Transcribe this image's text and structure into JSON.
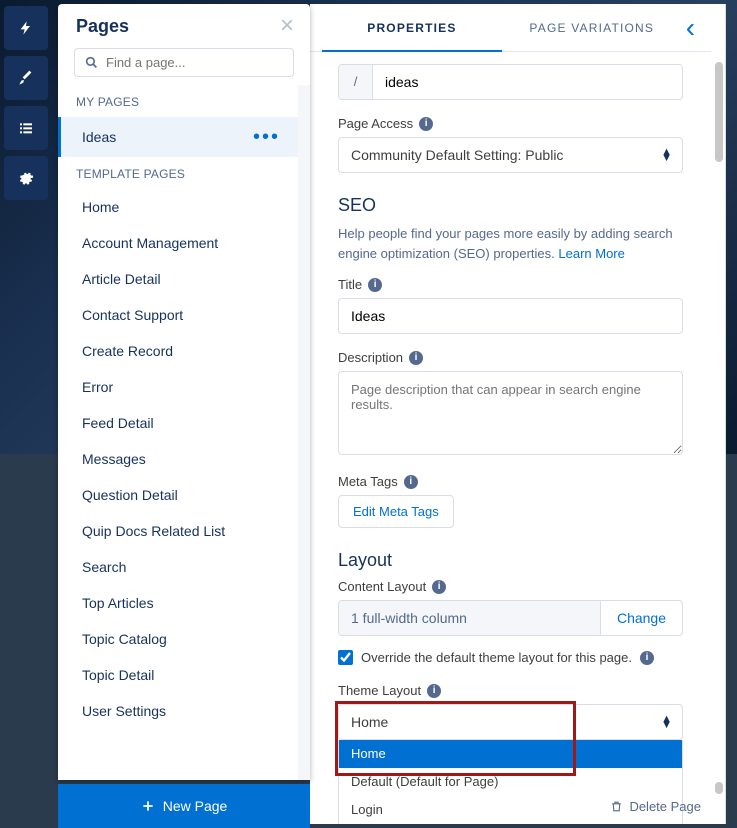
{
  "panel_title": "Pages",
  "search_placeholder": "Find a page...",
  "sections": {
    "my_pages": "MY PAGES",
    "template_pages": "TEMPLATE PAGES"
  },
  "my_pages": [
    {
      "label": "Ideas",
      "active": true
    }
  ],
  "template_pages": [
    "Home",
    "Account Management",
    "Article Detail",
    "Contact Support",
    "Create Record",
    "Error",
    "Feed Detail",
    "Messages",
    "Question Detail",
    "Quip Docs Related List",
    "Search",
    "Top Articles",
    "Topic Catalog",
    "Topic Detail",
    "User Settings"
  ],
  "new_page_label": "New Page",
  "tabs": {
    "properties": "PROPERTIES",
    "variations": "PAGE VARIATIONS"
  },
  "url": {
    "slash": "/",
    "value": "ideas"
  },
  "page_access": {
    "label": "Page Access",
    "value": "Community Default Setting: Public"
  },
  "seo": {
    "heading": "SEO",
    "help": "Help people find your pages more easily by adding search engine optimization (SEO) properties. ",
    "learn_more": "Learn More",
    "title_label": "Title",
    "title_value": "Ideas",
    "desc_label": "Description",
    "desc_placeholder": "Page description that can appear in search engine results.",
    "meta_label": "Meta Tags",
    "meta_button": "Edit Meta Tags"
  },
  "layout": {
    "heading": "Layout",
    "content_label": "Content Layout",
    "content_value": "1 full-width column",
    "change_label": "Change",
    "override_label": "Override the default theme layout for this page.",
    "theme_label": "Theme Layout",
    "theme_value": "Home",
    "options": [
      "Home",
      "Default (Default for Page)",
      "Login"
    ]
  },
  "delete_label": "Delete Page"
}
